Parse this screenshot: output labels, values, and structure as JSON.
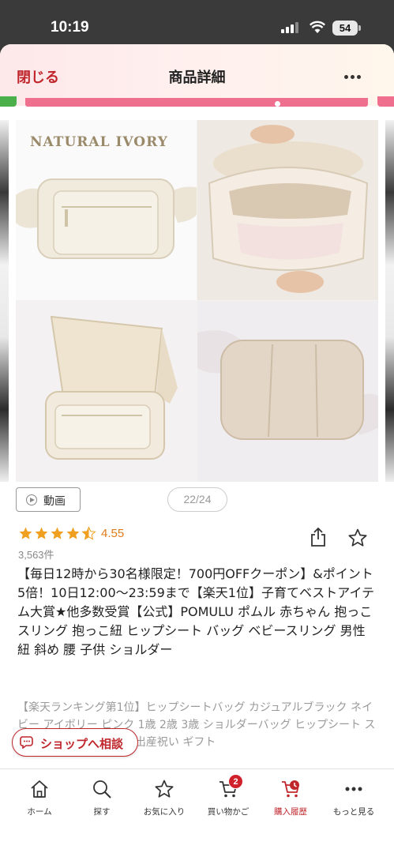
{
  "status_bar": {
    "time": "10:19",
    "battery": "54"
  },
  "header": {
    "close_label": "閉じる",
    "title": "商品詳細",
    "more_icon": "more-horizontal-icon"
  },
  "image_overlay": {
    "brand_text": "NATURAL IVORY"
  },
  "media": {
    "video_label": "動画",
    "page_counter": "22/24"
  },
  "rating": {
    "value": "4.55",
    "stars": 4.5,
    "review_count": "3,563件"
  },
  "product": {
    "title": "【毎日12時から30名様限定！700円OFFクーポン】&ポイント5倍！10日12:00～23:59まで【楽天1位】子育てベストアイテム大賞★他多数受賞【公式】POMULU ポムル 赤ちゃん 抱っこ スリング 抱っこ紐 ヒップシート バッグ ベビースリング 男性 紐 斜め 腰 子供 ショルダー",
    "description": "【楽天ランキング第1位】ヒップシートバッグ カジュアルブラック ネイビー アイボリー ピンク 1歳 2歳 3歳 ショルダーバッグ ヒップシート スリング抱っこ紐 大容量 出産祝い ギフト"
  },
  "consult_button": {
    "label": "ショップへ相談"
  },
  "bottom_nav": {
    "items": [
      {
        "label": "ホーム",
        "icon": "home-icon"
      },
      {
        "label": "探す",
        "icon": "search-icon"
      },
      {
        "label": "お気に入り",
        "icon": "star-icon"
      },
      {
        "label": "買い物かご",
        "icon": "cart-icon",
        "badge": "2"
      },
      {
        "label": "購入履歴",
        "icon": "purchase-history-icon"
      },
      {
        "label": "もっと見る",
        "icon": "more-horizontal-icon"
      }
    ]
  },
  "colors": {
    "accent": "#c0272d",
    "star": "#f0a020",
    "rating_text": "#e07b1a",
    "strip_pink": "#ee6f8e"
  }
}
